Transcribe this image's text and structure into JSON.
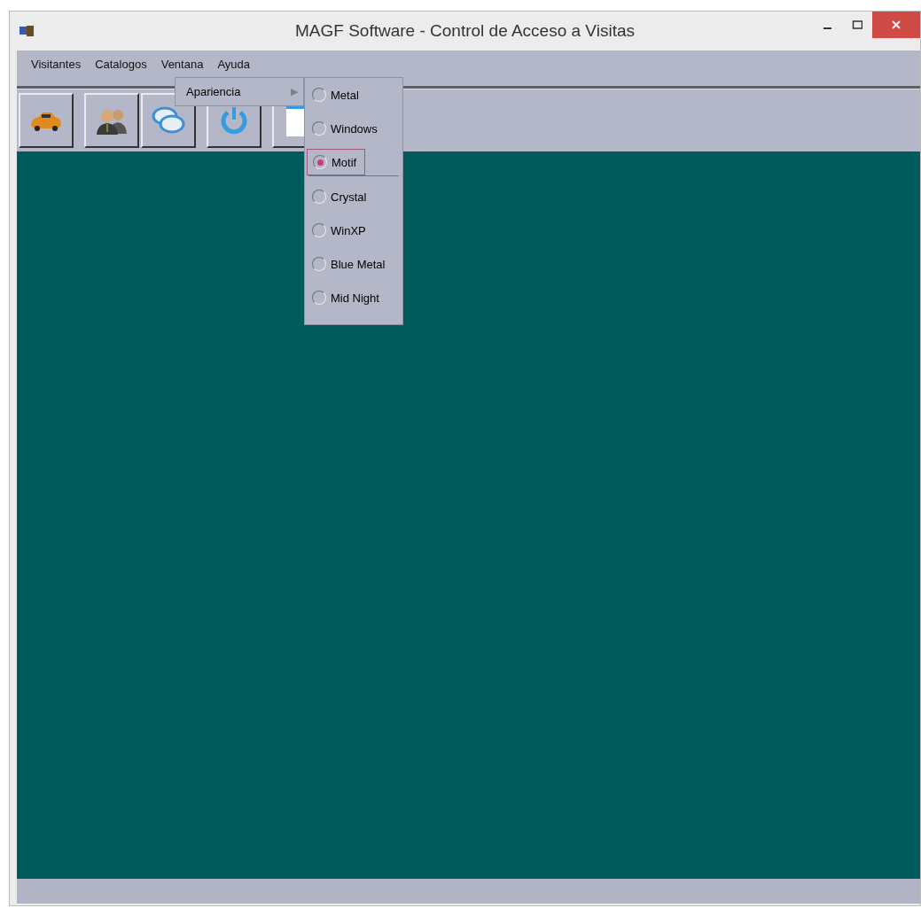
{
  "window": {
    "title": "MAGF Software - Control de Acceso a Visitas"
  },
  "menu_bar": [
    {
      "label": "Visitantes"
    },
    {
      "label": "Catalogos"
    },
    {
      "label": "Ventana"
    },
    {
      "label": "Ayuda"
    }
  ],
  "open_menu": {
    "items": [
      {
        "label": "Apariencia",
        "arrow": "▶"
      }
    ]
  },
  "submenu": {
    "items": [
      {
        "label": "Metal",
        "selected": false
      },
      {
        "label": "Windows",
        "selected": false
      },
      {
        "label": "Motif",
        "selected": true
      },
      {
        "label": "Crystal",
        "selected": false
      },
      {
        "label": "WinXP",
        "selected": false
      },
      {
        "label": "Blue Metal",
        "selected": false
      },
      {
        "label": "Mid Night",
        "selected": false
      }
    ]
  }
}
